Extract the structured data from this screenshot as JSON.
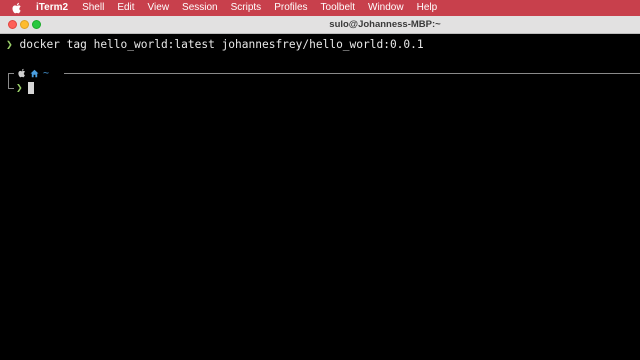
{
  "menubar": {
    "apple_icon": "apple-logo-icon",
    "app_name": "iTerm2",
    "items": [
      "Shell",
      "Edit",
      "View",
      "Session",
      "Scripts",
      "Profiles",
      "Toolbelt",
      "Window",
      "Help"
    ],
    "color": "#c8404c"
  },
  "window": {
    "title": "sulo@Johanness-MBP:~",
    "buttons": [
      "close",
      "minimize",
      "zoom"
    ]
  },
  "terminal": {
    "history": [
      {
        "prompt_symbol": "❯",
        "command": "docker tag hello_world:latest johannesfrey/hello_world:0.0.1"
      }
    ],
    "current_prompt": {
      "os_icon": "apple-logo-icon",
      "home_icon": "home-icon",
      "directory": "~",
      "prompt_symbol": "❯",
      "input": ""
    },
    "colors": {
      "prompt": "#9bd06a",
      "directory": "#4a9fe0",
      "background": "#000000"
    }
  }
}
